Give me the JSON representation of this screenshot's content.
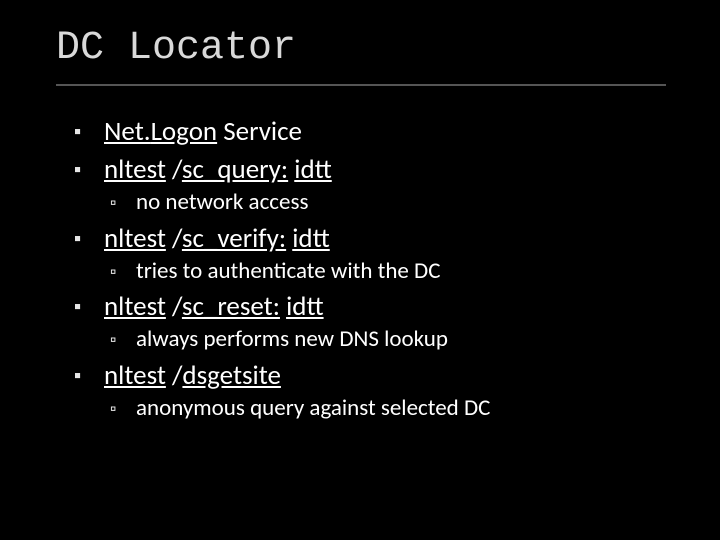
{
  "title": "DC Locator",
  "bullets": [
    {
      "parts": [
        {
          "text": "Net.",
          "underline": true
        },
        {
          "text": "Logon",
          "underline": true
        },
        {
          "text": " Service",
          "underline": false
        }
      ],
      "children": []
    },
    {
      "parts": [
        {
          "text": "nltest",
          "underline": true
        },
        {
          "text": " /",
          "underline": false
        },
        {
          "text": "sc_query:",
          "underline": true
        },
        {
          "text": " ",
          "underline": false
        },
        {
          "text": "idtt",
          "underline": true
        }
      ],
      "children": [
        {
          "parts": [
            {
              "text": "no network access",
              "underline": false
            }
          ]
        }
      ]
    },
    {
      "parts": [
        {
          "text": "nltest",
          "underline": true
        },
        {
          "text": " /",
          "underline": false
        },
        {
          "text": "sc_verify:",
          "underline": true
        },
        {
          "text": " ",
          "underline": false
        },
        {
          "text": "idtt",
          "underline": true
        }
      ],
      "children": [
        {
          "parts": [
            {
              "text": "tries to authenticate with the DC",
              "underline": false
            }
          ]
        }
      ]
    },
    {
      "parts": [
        {
          "text": "nltest",
          "underline": true
        },
        {
          "text": " /",
          "underline": false
        },
        {
          "text": "sc_reset:",
          "underline": true
        },
        {
          "text": " ",
          "underline": false
        },
        {
          "text": "idtt",
          "underline": true
        }
      ],
      "children": [
        {
          "parts": [
            {
              "text": "always performs new DNS lookup",
              "underline": false
            }
          ]
        }
      ]
    },
    {
      "parts": [
        {
          "text": "nltest",
          "underline": true
        },
        {
          "text": " /",
          "underline": false
        },
        {
          "text": "dsgetsite",
          "underline": true
        }
      ],
      "children": [
        {
          "parts": [
            {
              "text": "anonymous query against selected DC",
              "underline": false
            }
          ]
        }
      ]
    }
  ],
  "glyphs": {
    "square": "▪",
    "hollow": "▫"
  }
}
